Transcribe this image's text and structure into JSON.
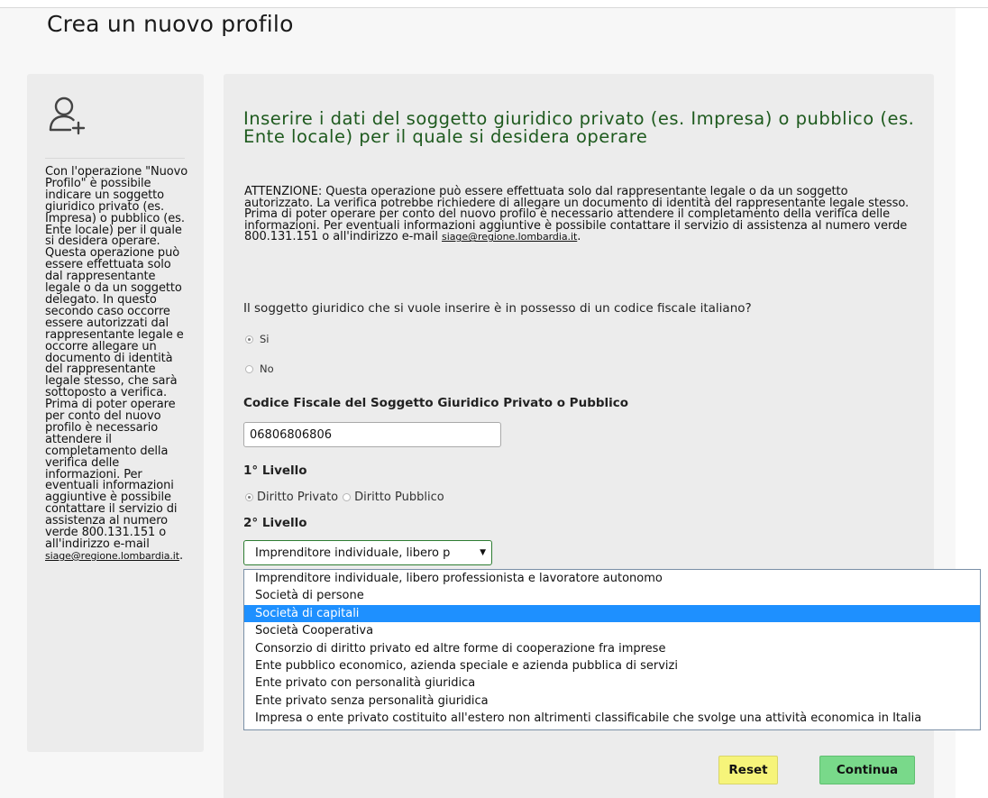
{
  "page": {
    "title": "Crea un nuovo profilo"
  },
  "sidebar": {
    "icon": "user-add-icon",
    "text": "Con l'operazione \"Nuovo Profilo\" è possibile indicare un soggetto giuridico privato (es. Impresa) o pubblico (es. Ente locale) per il quale si desidera operare. Questa operazione può essere effettuata solo dal rappresentante legale o da un soggetto delegato. In questo secondo caso occorre essere autorizzati dal rappresentante legale e occorre allegare un documento di identità del rappresentante legale stesso, che sarà sottoposto a verifica. Prima di poter operare per conto del nuovo profilo è necessario attendere il completamento della verifica delle informazioni. Per eventuali informazioni aggiuntive è possibile contattare il servizio di assistenza al numero verde 800.131.151 o all'indirizzo e-mail",
    "email": "siage@regione.lombardia.it",
    "email_suffix": "."
  },
  "main": {
    "heading": "Inserire i dati del soggetto giuridico privato (es. Impresa) o pubblico (es. Ente locale) per il quale si desidera operare",
    "attention": "ATTENZIONE: Questa operazione può essere effettuata solo dal rappresentante legale o da un soggetto autorizzato. La verifica potrebbe richiedere di allegare un documento di identità del rappresentante legale stesso. Prima di poter operare per conto del nuovo profilo è necessario attendere il completamento della verifica delle informazioni. Per eventuali informazioni aggiuntive è possibile contattare il servizio di assistenza al numero verde 800.131.151 o all'indirizzo e-mail",
    "attention_email": "siage@regione.lombardia.it",
    "attention_suffix": ".",
    "question": "Il soggetto giuridico che si vuole inserire è in possesso di un codice fiscale italiano?",
    "radio_si": "Si",
    "radio_no": "No",
    "cf_label": "Codice Fiscale del Soggetto Giuridico Privato o Pubblico",
    "cf_value": "06806806806",
    "level1_label": "1° Livello",
    "level1_private": "Diritto Privato",
    "level1_public": "Diritto Pubblico",
    "level2_label": "2° Livello",
    "level2_selected": "Imprenditore individuale, libero p",
    "level2_options": [
      "Imprenditore individuale, libero professionista e lavoratore autonomo",
      "Società di persone",
      "Società di capitali",
      "Società Cooperativa",
      "Consorzio di diritto privato ed altre forme di cooperazione fra imprese",
      "Ente pubblico economico, azienda speciale e azienda pubblica di servizi",
      "Ente privato con personalità giuridica",
      "Ente privato senza personalità giuridica",
      "Impresa o ente privato costituito all'estero non altrimenti classificabile che svolge una attività economica in Italia"
    ],
    "highlighted_option_index": 2
  },
  "buttons": {
    "reset": "Reset",
    "continue": "Continua"
  },
  "colors": {
    "heading_green": "#1e5a1e",
    "highlight_blue": "#1e90ff",
    "reset_yellow": "#f6f47a",
    "continue_green": "#79d98a"
  }
}
